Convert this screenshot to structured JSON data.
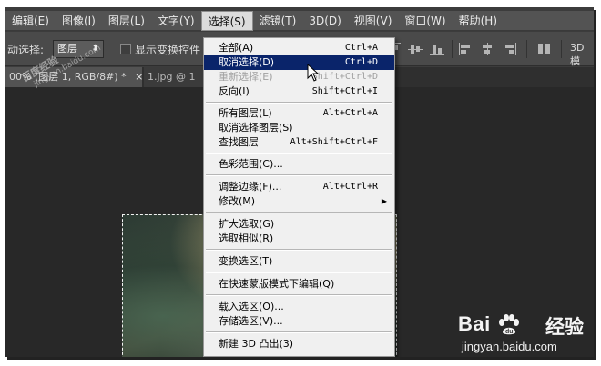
{
  "menubar": {
    "items": [
      {
        "label": "编辑(E)"
      },
      {
        "label": "图像(I)"
      },
      {
        "label": "图层(L)"
      },
      {
        "label": "文字(Y)"
      },
      {
        "label": "选择(S)"
      },
      {
        "label": "滤镜(T)"
      },
      {
        "label": "3D(D)"
      },
      {
        "label": "视图(V)"
      },
      {
        "label": "窗口(W)"
      },
      {
        "label": "帮助(H)"
      }
    ]
  },
  "options": {
    "auto_select_label": "动选择:",
    "auto_select_value": "图层",
    "show_transform_label": "显示变换控件",
    "label_3d": "3D 模"
  },
  "tabs": {
    "active": "00% (图层 1, RGB/8#) *",
    "close": "×",
    "inactive": "1.jpg @ 1"
  },
  "select_menu": {
    "items": [
      {
        "label": "全部(A)",
        "shortcut": "Ctrl+A"
      },
      {
        "label": "取消选择(D)",
        "shortcut": "Ctrl+D"
      },
      {
        "label": "重新选择(E)",
        "shortcut": "Shift+Ctrl+D"
      },
      {
        "label": "反向(I)",
        "shortcut": "Shift+Ctrl+I"
      },
      {
        "label": "所有图层(L)",
        "shortcut": "Alt+Ctrl+A"
      },
      {
        "label": "取消选择图层(S)",
        "shortcut": ""
      },
      {
        "label": "查找图层",
        "shortcut": "Alt+Shift+Ctrl+F"
      },
      {
        "label": "色彩范围(C)...",
        "shortcut": ""
      },
      {
        "label": "调整边缘(F)...",
        "shortcut": "Alt+Ctrl+R"
      },
      {
        "label": "修改(M)",
        "shortcut": ""
      },
      {
        "label": "扩大选取(G)",
        "shortcut": ""
      },
      {
        "label": "选取相似(R)",
        "shortcut": ""
      },
      {
        "label": "变换选区(T)",
        "shortcut": ""
      },
      {
        "label": "在快速蒙版模式下编辑(Q)",
        "shortcut": ""
      },
      {
        "label": "载入选区(O)...",
        "shortcut": ""
      },
      {
        "label": "存储选区(V)...",
        "shortcut": ""
      },
      {
        "label": "新建 3D 凸出(3)",
        "shortcut": ""
      }
    ],
    "submenu_arrow": "▶"
  },
  "watermark": {
    "line1": "百度经验",
    "line2": "jingyan.baidu.com"
  },
  "baidu": {
    "logo_left": "Bai",
    "logo_right": "经验",
    "url": "jingyan.baidu.com"
  },
  "colors": {
    "menu_highlight": "#0a246a",
    "menubar_bg": "#535353",
    "menu_bg": "#f0f0f0"
  }
}
